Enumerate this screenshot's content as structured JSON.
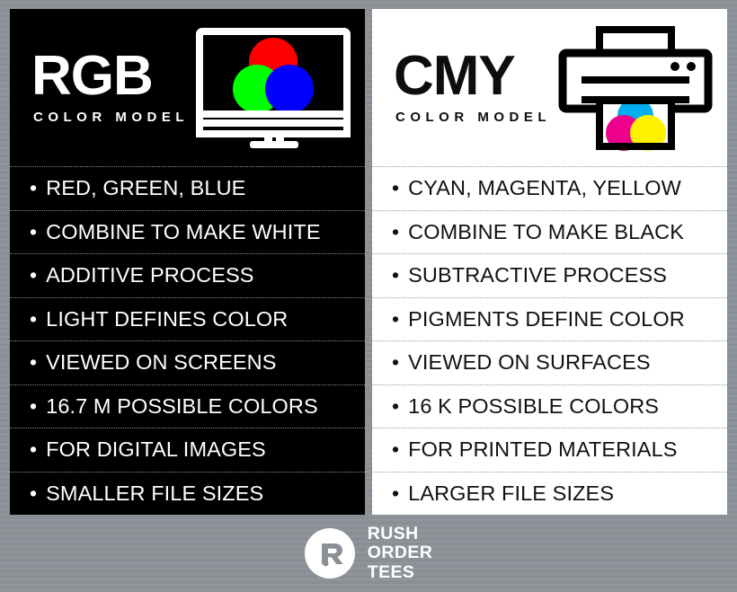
{
  "theme": {
    "background_metal": "#8a9096",
    "rgb_panel_bg": "#000000",
    "rgb_panel_fg": "#ffffff",
    "cmy_panel_bg": "#ffffff",
    "cmy_panel_fg": "#111111",
    "red": "#ff0000",
    "green": "#00e000",
    "blue": "#0000ff",
    "cyan": "#00aeef",
    "magenta": "#ec008c",
    "yellow": "#fff200"
  },
  "panels": [
    {
      "id": "rgb",
      "title": "RGB",
      "subtitle": "COLOR MODEL",
      "icon_name": "monitor-rgb-venn-icon",
      "bullet": "•",
      "items": [
        "RED, GREEN, BLUE",
        "COMBINE TO MAKE WHITE",
        "ADDITIVE PROCESS",
        "LIGHT DEFINES COLOR",
        "VIEWED ON SCREENS",
        "16.7 M POSSIBLE COLORS",
        "FOR DIGITAL IMAGES",
        "SMALLER FILE SIZES"
      ]
    },
    {
      "id": "cmy",
      "title": "CMY",
      "subtitle": "COLOR MODEL",
      "icon_name": "printer-cmy-venn-icon",
      "bullet": "•",
      "items": [
        "CYAN, MAGENTA, YELLOW",
        "COMBINE TO MAKE BLACK",
        "SUBTRACTIVE PROCESS",
        "PIGMENTS DEFINE COLOR",
        "VIEWED ON SURFACES",
        "16 K POSSIBLE COLORS",
        "FOR PRINTED MATERIALS",
        "LARGER FILE SIZES"
      ]
    }
  ],
  "footer": {
    "logo_line1": "RUSH",
    "logo_line2": "ORDER",
    "logo_line3": "TEES",
    "logo_mark_name": "rushordertees-r-monogram"
  }
}
